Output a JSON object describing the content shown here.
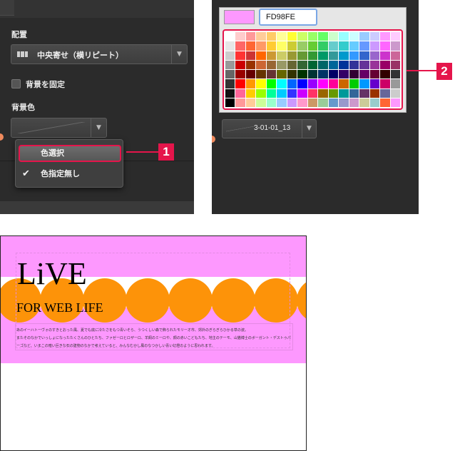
{
  "left_panel": {
    "layout_label": "配置",
    "layout_value": "中央寄せ（横リピート）",
    "fixed_bg_label": "背景を固定",
    "bg_color_label": "背景色",
    "dropdown": {
      "items": [
        {
          "label": "色選択",
          "highlighted": true
        },
        {
          "label": "色指定無し",
          "checked": true
        }
      ]
    },
    "callout": "1"
  },
  "right_panel": {
    "hex_value": "FD98FE",
    "selected_color": "#fd98fe",
    "image_select": "3-01-01_13",
    "callout": "2"
  },
  "preview": {
    "title": "LiVE",
    "subtitle": "FOR WEB LIFE",
    "body_lines": [
      "あのイーハトーヴォのすきとおった風、夏でも底に冷たさをもつ青いそら、うつくしい森で飾られたモリーオ市、郊外のぎらぎらひかる草の波。",
      "またそのなかでいっしょになったたくさんのひとたち、ファゼーロとロザーロ、羊飼のミーロや、顔の赤いこどもたち、地主のテーモ、山猫博士のボーガント・デストゥパーゴなど、いまこの暗い巨きな石の建物のなかで考えていると、みんなむかし風のなつかしい青い幻燈のように思われます。"
    ],
    "band_color": "#fd98fe",
    "circle_color": "#fd9309"
  },
  "colors": {
    "accent_red": "#e5154b",
    "panel_bg": "#2b2b2b"
  }
}
